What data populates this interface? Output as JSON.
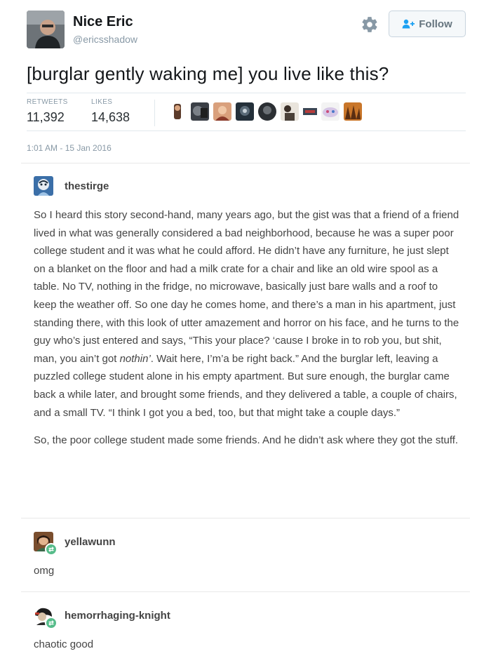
{
  "tweet": {
    "display_name": "Nice Eric",
    "screen_name": "@ericsshadow",
    "follow_label": "Follow",
    "text": "[burglar gently waking me] you live like this?",
    "retweets_label": "RETWEETS",
    "retweets_count": "11,392",
    "likes_label": "LIKES",
    "likes_count": "14,638",
    "timestamp": "1:01 AM - 15 Jan 2016",
    "likers": [
      "liker-1",
      "liker-2",
      "liker-3",
      "liker-4",
      "liker-5",
      "liker-6",
      "liker-7",
      "liker-8",
      "liker-9"
    ]
  },
  "posts": [
    {
      "username": "thestirge",
      "paragraphs": [
        {
          "before": "So I heard this story second-hand, many years ago, but the gist was that a friend of a friend lived in what was generally considered a bad neighborhood, because he was a super poor college student and it was what he could afford. He didn’t have any furniture, he just slept on a blanket on the floor and had a milk crate for a chair and like an old wire spool as a table. No TV, nothing in the fridge, no microwave, basically just bare walls and a roof to keep the weather off. So one day he comes home, and there’s a man in his apartment, just standing there, with this look of utter amazement and horror on his face, and he turns to the guy who’s just entered and says, “This your place? ‘cause I broke in to rob you, but shit, man, you ain’t got ",
          "emphasis": "nothin’",
          "after": ". Wait here, I’m’a be right back.” And the burglar left, leaving a puzzled college student alone in his empty apartment. But sure enough, the burglar came back a while later, and brought some friends, and they delivered a table, a couple of chairs, and a small TV. “I think I got you a bed, too, but that might take a couple days.”"
        },
        {
          "text": "So, the poor college student made some friends. And he didn’t ask where they got the stuff."
        }
      ]
    },
    {
      "username": "yellawunn",
      "text": "omg"
    },
    {
      "username": "hemorrhaging-knight",
      "text": "chaotic good"
    }
  ],
  "colors": {
    "reblog_badge": "#56bc8a",
    "muted_text": "#8899a6",
    "tumblr_text": "#444444"
  }
}
